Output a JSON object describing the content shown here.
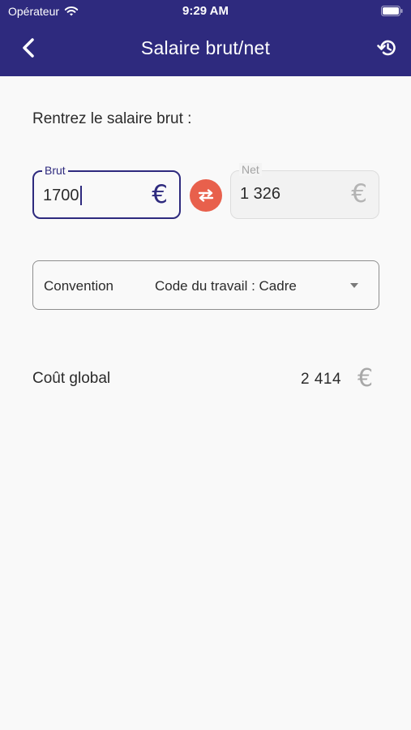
{
  "status_bar": {
    "carrier": "Opérateur",
    "time": "9:29 AM"
  },
  "header": {
    "title": "Salaire brut/net",
    "back_icon": "chevron-left-icon",
    "reset_icon": "history-reset-icon"
  },
  "form": {
    "prompt": "Rentrez le salaire brut :",
    "brut": {
      "label": "Brut",
      "value": "1700",
      "currency": "€"
    },
    "net": {
      "label": "Net",
      "value": "1 326",
      "currency": "€"
    },
    "swap_icon": "swap-arrows-icon",
    "convention": {
      "label": "Convention",
      "selected": "Code du travail : Cadre"
    }
  },
  "result": {
    "label": "Coût global",
    "value": "2 414",
    "currency": "€"
  },
  "colors": {
    "header_bg": "#2e2a7e",
    "accent": "#2e2a7e",
    "swap_button": "#e8604c",
    "background": "#f9f9f9"
  }
}
